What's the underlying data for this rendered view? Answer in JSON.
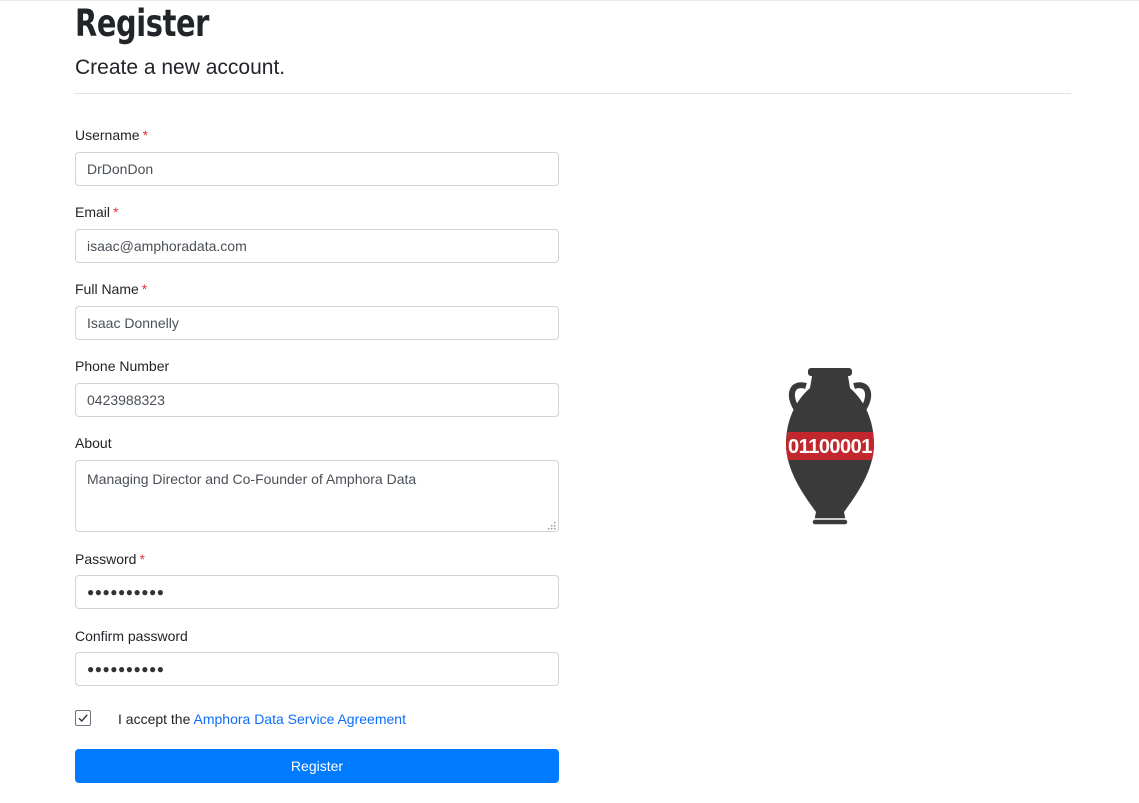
{
  "header": {
    "title": "Register",
    "subtitle": "Create a new account."
  },
  "form": {
    "required_marker": "*",
    "username": {
      "label": "Username",
      "value": "DrDonDon"
    },
    "email": {
      "label": "Email",
      "value": "isaac@amphoradata.com"
    },
    "full_name": {
      "label": "Full Name",
      "value": "Isaac Donnelly"
    },
    "phone": {
      "label": "Phone Number",
      "value": "0423988323"
    },
    "about": {
      "label": "About",
      "value": "Managing Director and Co-Founder of Amphora Data"
    },
    "password": {
      "label": "Password",
      "masked_value": "●●●●●●●●●●"
    },
    "confirm_password": {
      "label": "Confirm password",
      "masked_value": "●●●●●●●●●●"
    },
    "agreement": {
      "checked": true,
      "prefix": "I accept the",
      "link_text": "Amphora Data Service Agreement"
    },
    "submit_label": "Register"
  },
  "logo": {
    "icon": "amphora-logo-icon",
    "text": "01100001"
  },
  "colors": {
    "primary": "#007bff",
    "link": "#0d6efd",
    "required": "#dc3545",
    "logo_body": "#3a3a3a",
    "logo_band": "#c1272d"
  }
}
